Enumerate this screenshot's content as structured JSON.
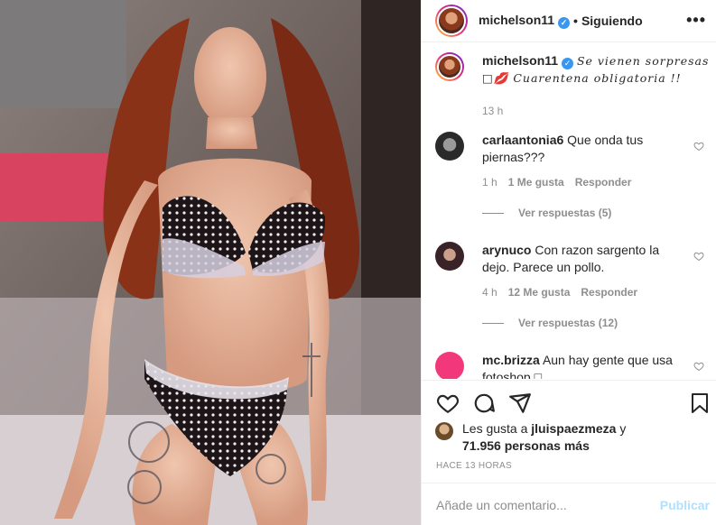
{
  "post": {
    "username": "michelson11",
    "verified_mark": "✓",
    "separator": "•",
    "follow_status": "Siguiendo",
    "more_label": "•••"
  },
  "caption": {
    "username": "michelson11",
    "verified_mark": "✓",
    "text_line1": "Se vienen sorpresas",
    "text_line2": "□💋 Cuarentena obligatoria !!",
    "time": "13 h"
  },
  "comments": [
    {
      "username": "carlaantonia6",
      "text": "Que onda tus piernas???",
      "time": "1 h",
      "likes": "1 Me gusta",
      "reply": "Responder",
      "view_replies": "Ver respuestas (5)"
    },
    {
      "username": "arynuco",
      "text": "Con razon sargento la dejo. Parece un pollo.",
      "time": "4 h",
      "likes": "12 Me gusta",
      "reply": "Responder",
      "view_replies": "Ver respuestas (12)"
    },
    {
      "username": "mc.brizza",
      "text": "Aun hay gente que usa fotoshop □"
    }
  ],
  "likes": {
    "prefix": "Les gusta a",
    "user": "jluispaezmeza",
    "suffix": "y",
    "count": "71.956 personas más"
  },
  "timestamp": "HACE 13 HORAS",
  "add_comment": {
    "placeholder": "Añade un comentario...",
    "publish": "Publicar"
  },
  "icons": [
    "heart-icon",
    "comment-icon",
    "share-icon",
    "bookmark-icon",
    "more-icon"
  ]
}
